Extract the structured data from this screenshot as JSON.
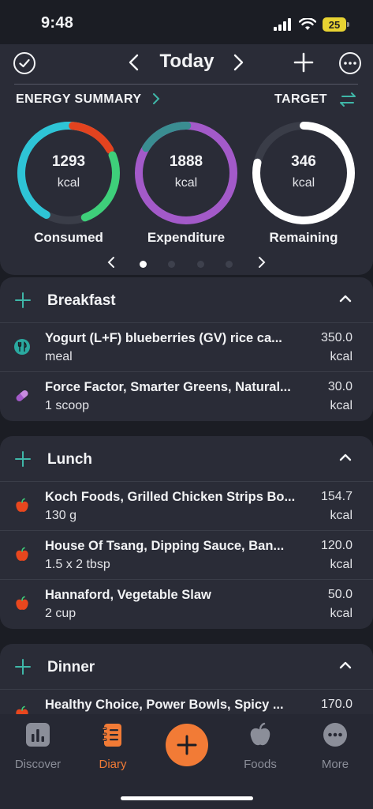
{
  "status": {
    "time": "9:48",
    "battery": "25"
  },
  "header": {
    "title": "Today"
  },
  "summary": {
    "label": "ENERGY SUMMARY",
    "target_label": "TARGET"
  },
  "rings": [
    {
      "value": "1293",
      "unit": "kcal",
      "label": "Consumed"
    },
    {
      "value": "1888",
      "unit": "kcal",
      "label": "Expenditure"
    },
    {
      "value": "346",
      "unit": "kcal",
      "label": "Remaining"
    }
  ],
  "colors": {
    "accent": "#f27b36",
    "teal": "#3fb7a8",
    "ring_cyan": "#2ec4d6",
    "ring_red": "#e3431f",
    "ring_green": "#3ecf7a",
    "ring_purple": "#a35ac9",
    "ring_track": "#3a3d48"
  },
  "meals": [
    {
      "title": "Breakfast",
      "items": [
        {
          "name": "Yogurt (L+F) blueberries (GV) rice ca...",
          "amount": "meal",
          "cal": "350.0",
          "unit": "kcal",
          "icon": "fork-knife-icon"
        },
        {
          "name": "Force Factor, Smarter Greens, Natural...",
          "amount": "1 scoop",
          "cal": "30.0",
          "unit": "kcal",
          "icon": "pill-icon"
        }
      ]
    },
    {
      "title": "Lunch",
      "items": [
        {
          "name": "Koch Foods, Grilled Chicken Strips Bo...",
          "amount": "130 g",
          "cal": "154.7",
          "unit": "kcal",
          "icon": "apple-icon"
        },
        {
          "name": "House Of Tsang, Dipping Sauce, Ban...",
          "amount": "1.5 x 2 tbsp",
          "cal": "120.0",
          "unit": "kcal",
          "icon": "apple-icon"
        },
        {
          "name": "Hannaford, Vegetable Slaw",
          "amount": "2 cup",
          "cal": "50.0",
          "unit": "kcal",
          "icon": "apple-icon"
        }
      ]
    },
    {
      "title": "Dinner",
      "items": [
        {
          "name": "Healthy Choice, Power Bowls, Spicy ...",
          "cal": "170.0",
          "icon": "apple-icon"
        }
      ]
    }
  ],
  "tabs": [
    {
      "label": "Discover",
      "icon": "bar-chart-icon"
    },
    {
      "label": "Diary",
      "icon": "notebook-icon"
    },
    {
      "label": "Foods",
      "icon": "apple-icon"
    },
    {
      "label": "More",
      "icon": "more-icon"
    }
  ]
}
